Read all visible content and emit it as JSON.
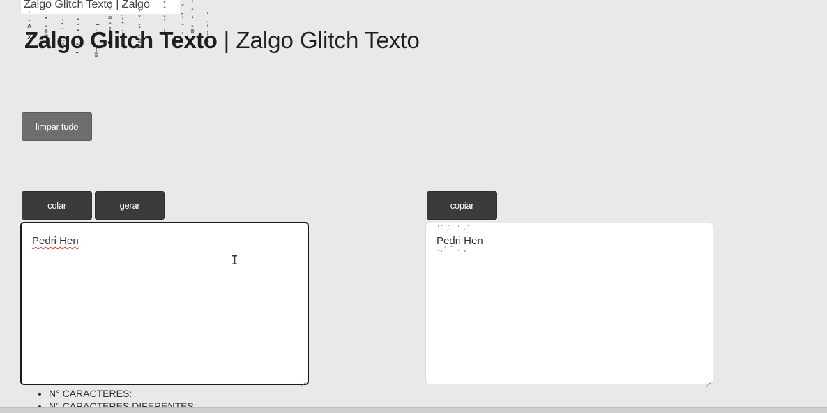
{
  "header": {
    "top_strip_text": "Zalgo Glitch Texto | Zalgo",
    "title_zalgo": "Zalgo Glitch Texto",
    "title_plain": " | Zalgo Glitch Texto"
  },
  "toolbar": {
    "clear_all_label": "limpar tudo",
    "paste_label": "colar",
    "generate_label": "gerar",
    "copy_label": "copiar"
  },
  "input": {
    "value": "Pedri Hen"
  },
  "output": {
    "value": "Pedri Hen"
  },
  "stats": {
    "chars_label": "N° CARACTERES:",
    "unique_chars_label": "N° CARACTERES DIFERENTES:"
  },
  "glitch_marks": [
    "ˇ°ˈ-ʌ͟x",
    "˘¸ˈ-ʬʭ",
    "ˌ˶-˳ʭ◊",
    "ˇ˘˚ʼ<˷",
    "͞ˈ˙ˌ:ʬ",
    "ˇ˙=-:ˌ▂",
    "ˌ˚˵ʼˉ:",
    "ˈˇ-˚-ʬ≡",
    "ˇ˚-ʼˌ:",
    "ˇ˶ʼ-˳ˈ",
    "ˈ-ˌˇ-ʬ",
    "ˌˇ-ʼ:ˍ"
  ]
}
